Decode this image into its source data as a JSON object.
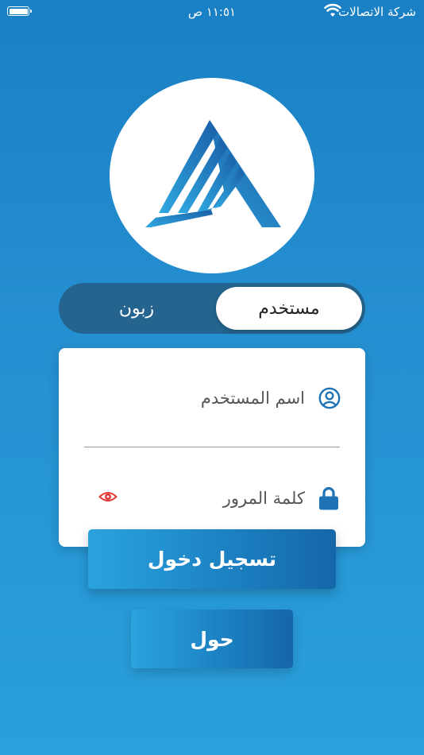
{
  "status_bar": {
    "carrier": "شركة الاتصالات",
    "time": "١١:٥١ ص"
  },
  "logo": {
    "icon": "brand-logo-icon"
  },
  "segment": {
    "user_label": "مستخدم",
    "customer_label": "زبون",
    "selected": "user"
  },
  "form": {
    "username_placeholder": "اسم المستخدم",
    "password_placeholder": "كلمة المرور",
    "username_icon": "user-circle-icon",
    "password_icon": "lock-icon",
    "visibility_icon": "eye-icon"
  },
  "buttons": {
    "login_label": "تسجيل دخول",
    "about_label": "حول"
  },
  "colors": {
    "background_top": "#1a7fc4",
    "background_bottom": "#2aa0dc",
    "segment_track": "#24648e",
    "accent_blue": "#1e73b6",
    "eye_red": "#e53935"
  }
}
